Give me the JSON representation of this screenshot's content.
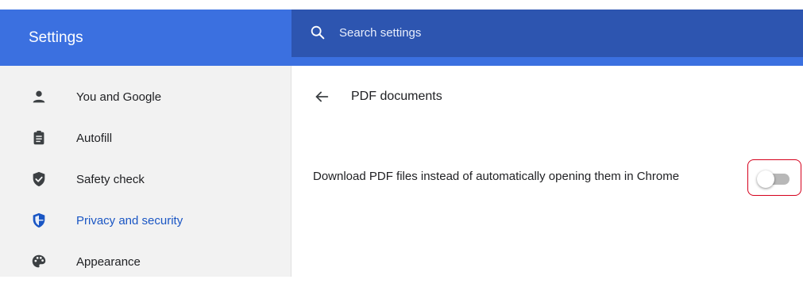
{
  "header": {
    "title": "Settings",
    "search_placeholder": "Search settings",
    "color": "#3b70e0",
    "search_color": "#2d55b0"
  },
  "sidebar": {
    "items": [
      {
        "label": "You and Google",
        "icon": "person-icon",
        "active": false
      },
      {
        "label": "Autofill",
        "icon": "clipboard-icon",
        "active": false
      },
      {
        "label": "Safety check",
        "icon": "shield-check-icon",
        "active": false
      },
      {
        "label": "Privacy and security",
        "icon": "shield-icon",
        "active": true
      },
      {
        "label": "Appearance",
        "icon": "palette-icon",
        "active": false
      }
    ]
  },
  "main": {
    "title": "PDF documents",
    "setting": {
      "label": "Download PDF files instead of automatically opening them in Chrome",
      "enabled": false
    }
  },
  "colors": {
    "accent": "#1a56c4",
    "highlight_border": "#d5001c"
  }
}
